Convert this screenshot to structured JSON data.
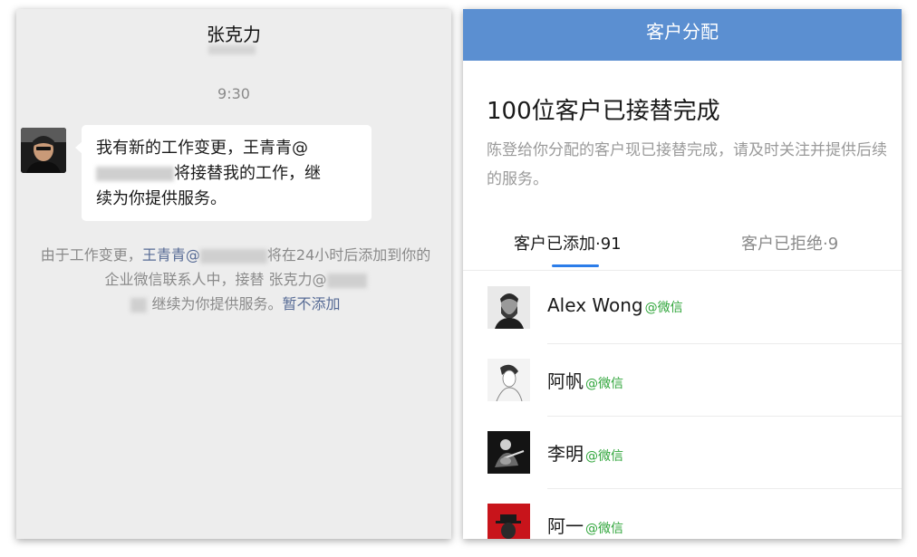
{
  "chat": {
    "title": "张克力",
    "time": "9:30",
    "message_line1": "我有新的工作变更，王青青@",
    "message_line2": "将接替我的工作，继",
    "message_line3": "续为你提供服务。",
    "system_part1": "由于工作变更，",
    "system_link_name": "王青青@",
    "system_part2": "将在24小时后添加到你的企业微信联系人中，接替 张克力@",
    "system_part3": "继续为你提供服务。",
    "system_link_action": "暂不添加"
  },
  "panel": {
    "nav_title": "客户分配",
    "headline": "100位客户已接替完成",
    "description": "陈登给你分配的客户现已接替完成，请及时关注并提供后续的服务。",
    "tabs": [
      {
        "label": "客户已添加·91",
        "active": true
      },
      {
        "label": "客户已拒绝·9",
        "active": false
      }
    ],
    "customers": [
      {
        "name": "Alex Wong",
        "tag": "@微信"
      },
      {
        "name": "阿帆",
        "tag": "@微信"
      },
      {
        "name": "李明",
        "tag": "@微信"
      },
      {
        "name": "阿一",
        "tag": "@微信"
      }
    ]
  },
  "colors": {
    "nav_bg": "#5b8fd1",
    "accent_blue": "#2b7de9",
    "wechat_green": "#2fa53a",
    "link": "#576b95"
  }
}
